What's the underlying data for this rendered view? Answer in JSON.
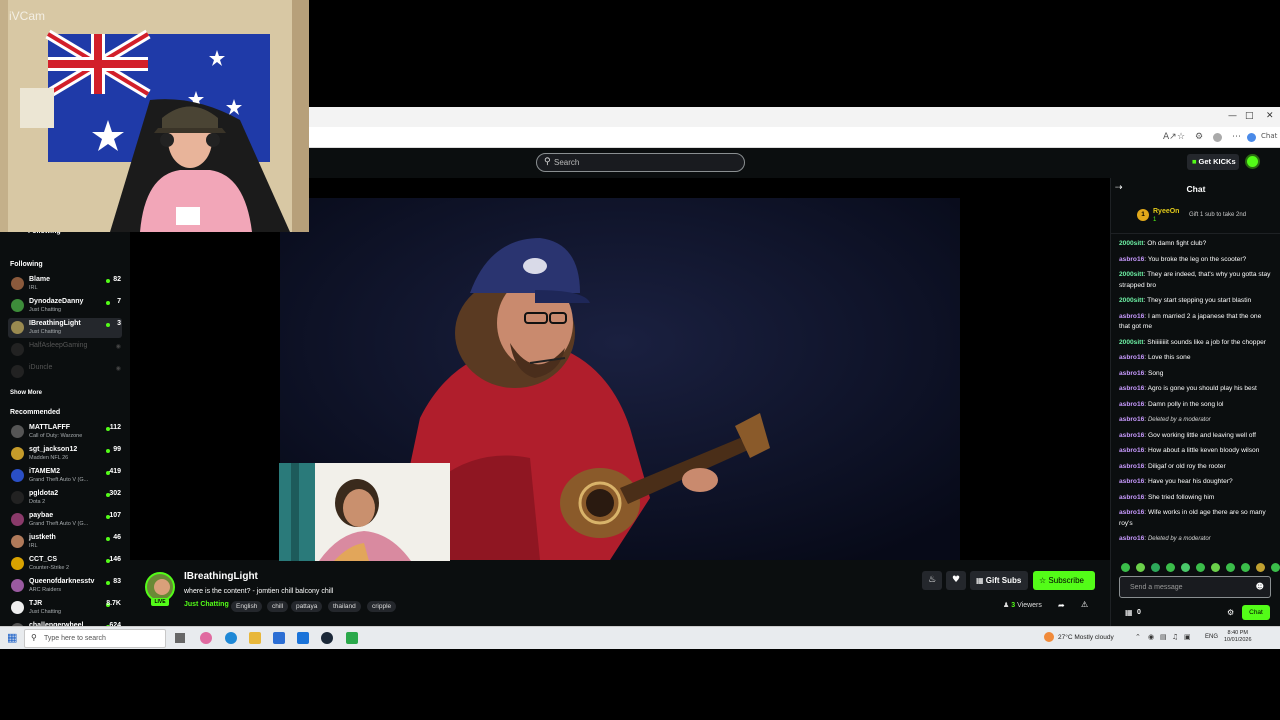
{
  "webcam": {
    "watermark": "iVCam"
  },
  "browser": {
    "chat_button": "Chat"
  },
  "topnav": {
    "search_placeholder": "Search",
    "get_kicks": "Get KICKs"
  },
  "sidebar": {
    "following_toggle": "Following",
    "following_heading": "Following",
    "following": [
      {
        "name": "Blame",
        "category": "IRL",
        "viewers": "82",
        "color": "#8b5a3c"
      },
      {
        "name": "DynodazeDanny",
        "category": "Just Chatting",
        "viewers": "7",
        "color": "#3d8d3a"
      },
      {
        "name": "IBreathingLight",
        "category": "Just Chatting",
        "viewers": "3",
        "color": "#9a8a50",
        "active": true
      }
    ],
    "offline": [
      {
        "name": "HalfAsleepGaming"
      },
      {
        "name": "iDuncle"
      }
    ],
    "show_more": "Show More",
    "recommended_heading": "Recommended",
    "recommended": [
      {
        "name": "MATTLAFFF",
        "category": "Call of Duty: Warzone",
        "viewers": "112",
        "color": "#555"
      },
      {
        "name": "sgt_jackson12",
        "category": "Madden NFL 26",
        "viewers": "99",
        "color": "#c59b2a"
      },
      {
        "name": "iTAMEM2",
        "category": "Grand Theft Auto V (G...",
        "viewers": "419",
        "color": "#2a4fc5"
      },
      {
        "name": "pgldota2",
        "category": "Dota 2",
        "viewers": "302",
        "color": "#222"
      },
      {
        "name": "paybae",
        "category": "Grand Theft Auto V (G...",
        "viewers": "107",
        "color": "#8a3a6a"
      },
      {
        "name": "justketh",
        "category": "IRL",
        "viewers": "46",
        "color": "#b07a5a"
      },
      {
        "name": "CCT_CS",
        "category": "Counter-Strike 2",
        "viewers": "146",
        "color": "#d8a200"
      },
      {
        "name": "Queenofdarknesstv",
        "category": "ARC Raiders",
        "viewers": "83",
        "color": "#9a5aa0"
      },
      {
        "name": "TJR",
        "category": "Just Chatting",
        "viewers": "8.7K",
        "color": "#eee"
      },
      {
        "name": "challengerwheel",
        "category": "",
        "viewers": "624",
        "color": "#555"
      }
    ]
  },
  "stream": {
    "live_badge": "LIVE",
    "streamer": "IBreathingLight",
    "title": "where is the content? - jomtien chill balcony chill",
    "category": "Just Chatting",
    "tags": [
      "English",
      "chill",
      "pattaya",
      "thailand",
      "cripple"
    ],
    "gift_subs": "Gift Subs",
    "subscribe": "Subscribe",
    "viewer_count": "3",
    "viewers_label": "Viewers"
  },
  "chat": {
    "title": "Chat",
    "pinned": {
      "user": "RyeeOn",
      "badge": "1",
      "subline": "1",
      "message": "Gift 1 sub to take 2nd"
    },
    "messages": [
      {
        "user": "2000sitt",
        "color": "green",
        "text": "Oh damn fight club?"
      },
      {
        "user": "asbro16",
        "color": "purple",
        "text": "You broke the leg on the scooter?"
      },
      {
        "user": "2000sitt",
        "color": "green",
        "text": "They are indeed, that's why you gotta stay strapped bro"
      },
      {
        "user": "2000sitt",
        "color": "green",
        "text": "They start stepping you start blastin"
      },
      {
        "user": "asbro16",
        "color": "purple",
        "text": "I am married 2 a japanese that the one that got me"
      },
      {
        "user": "2000sitt",
        "color": "green",
        "text": "Shiiiiiiiit sounds like a job for the chopper"
      },
      {
        "user": "asbro16",
        "color": "purple",
        "text": "Love this sone"
      },
      {
        "user": "asbro16",
        "color": "purple",
        "text": "Song"
      },
      {
        "user": "asbro16",
        "color": "purple",
        "text": "Agro is gone you should play his best"
      },
      {
        "user": "asbro16",
        "color": "purple",
        "text": "Damn polly in the song lol"
      },
      {
        "user": "asbro16",
        "color": "purple",
        "text": "Deleted by a moderator",
        "deleted": true
      },
      {
        "user": "asbro16",
        "color": "purple",
        "text": "Gov working little and leaving well off"
      },
      {
        "user": "asbro16",
        "color": "purple",
        "text": "How about a little keven bloody wilson"
      },
      {
        "user": "asbro16",
        "color": "purple",
        "text": "Diligaf or old roy the rooter"
      },
      {
        "user": "asbro16",
        "color": "purple",
        "text": "Have you hear his doughter?"
      },
      {
        "user": "asbro16",
        "color": "purple",
        "text": "She tried following him"
      },
      {
        "user": "asbro16",
        "color": "purple",
        "text": "Wife works in old age there are so many roy's"
      },
      {
        "user": "asbro16",
        "color": "purple",
        "text": "Deleted by a moderator",
        "deleted": true
      }
    ],
    "input_placeholder": "Send a message",
    "gift_count": "0",
    "send_label": "Chat"
  },
  "taskbar": {
    "search_placeholder": "Type here to search",
    "weather": "27°C  Mostly cloudy",
    "lang": "ENG",
    "time": "8:40 PM",
    "date": "10/01/2026"
  }
}
